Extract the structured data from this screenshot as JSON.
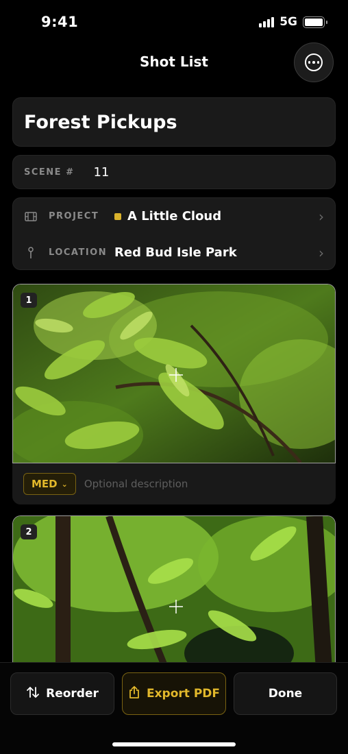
{
  "status_bar": {
    "time": "9:41",
    "network": "5G",
    "signal_bars": 4,
    "battery_level": 1.0
  },
  "nav": {
    "title": "Shot List",
    "more_icon": "ellipsis-circle-icon"
  },
  "shot_list": {
    "title": "Forest Pickups",
    "scene": {
      "label": "SCENE #",
      "value": "11"
    },
    "project": {
      "label": "PROJECT",
      "value": "A Little Cloud",
      "color": "#d9b22c",
      "icon": "film-icon"
    },
    "location": {
      "label": "LOCATION",
      "value": "Red Bud Isle Park",
      "icon": "pin-icon"
    }
  },
  "shots": [
    {
      "number": "1",
      "size": "MED",
      "description": "",
      "placeholder": "Optional description"
    },
    {
      "number": "2"
    }
  ],
  "bottom_bar": {
    "reorder": "Reorder",
    "export": "Export PDF",
    "done": "Done"
  },
  "colors": {
    "accent": "#e2b82b",
    "background": "#000000",
    "card": "#1a1a1a"
  }
}
